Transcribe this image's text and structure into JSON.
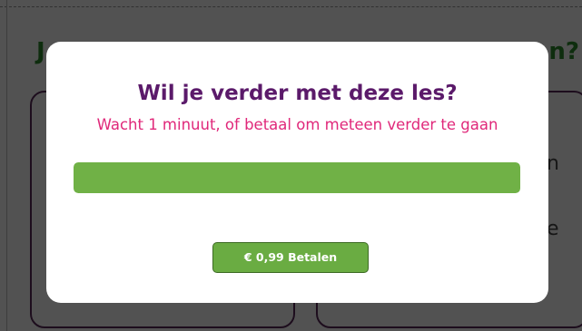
{
  "background": {
    "heading_left": "J",
    "heading_right": "n?",
    "card_text_1": "n",
    "card_text_2": "e"
  },
  "modal": {
    "title": "Wil je verder met deze les?",
    "subtitle": "Wacht 1 minuut, of betaal om meteen verder te gaan",
    "progress_fraction": 1.0,
    "pay_button_label": "€ 0,99 Betalen"
  },
  "colors": {
    "title": "#5b1a6a",
    "subtitle": "#e0287a",
    "progress": "#70b146",
    "button": "#6aac42",
    "heading_green": "#2e8b2e"
  }
}
